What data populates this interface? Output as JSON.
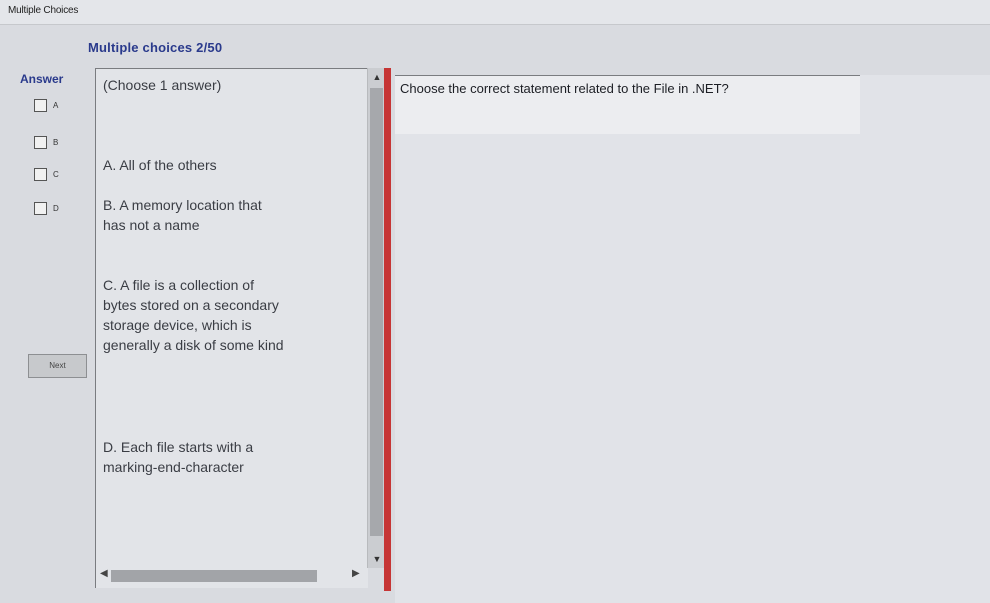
{
  "window": {
    "title": "Multiple Choices"
  },
  "header": {
    "progress": "Multiple choices 2/50"
  },
  "answer": {
    "label": "Answer",
    "options": [
      {
        "letter": "A"
      },
      {
        "letter": "B"
      },
      {
        "letter": "C"
      },
      {
        "letter": "D"
      }
    ],
    "next_label": "Next"
  },
  "options_panel": {
    "instruction": "(Choose 1 answer)",
    "choices": [
      "A. All of the others",
      "B. A memory location that has not a name",
      "C. A file is a collection of bytes stored on a secondary storage device, which is generally a disk of some kind",
      "D. Each file starts with a marking-end-character"
    ]
  },
  "question": {
    "text": "Choose the correct statement related to the File in .NET?"
  },
  "colors": {
    "accent": "#2a3a8c",
    "divider": "#c63535"
  },
  "icons": {
    "scroll_up": "chevron-up-icon",
    "scroll_down": "chevron-down-icon",
    "scroll_left": "chevron-left-icon",
    "scroll_right": "chevron-right-icon"
  }
}
